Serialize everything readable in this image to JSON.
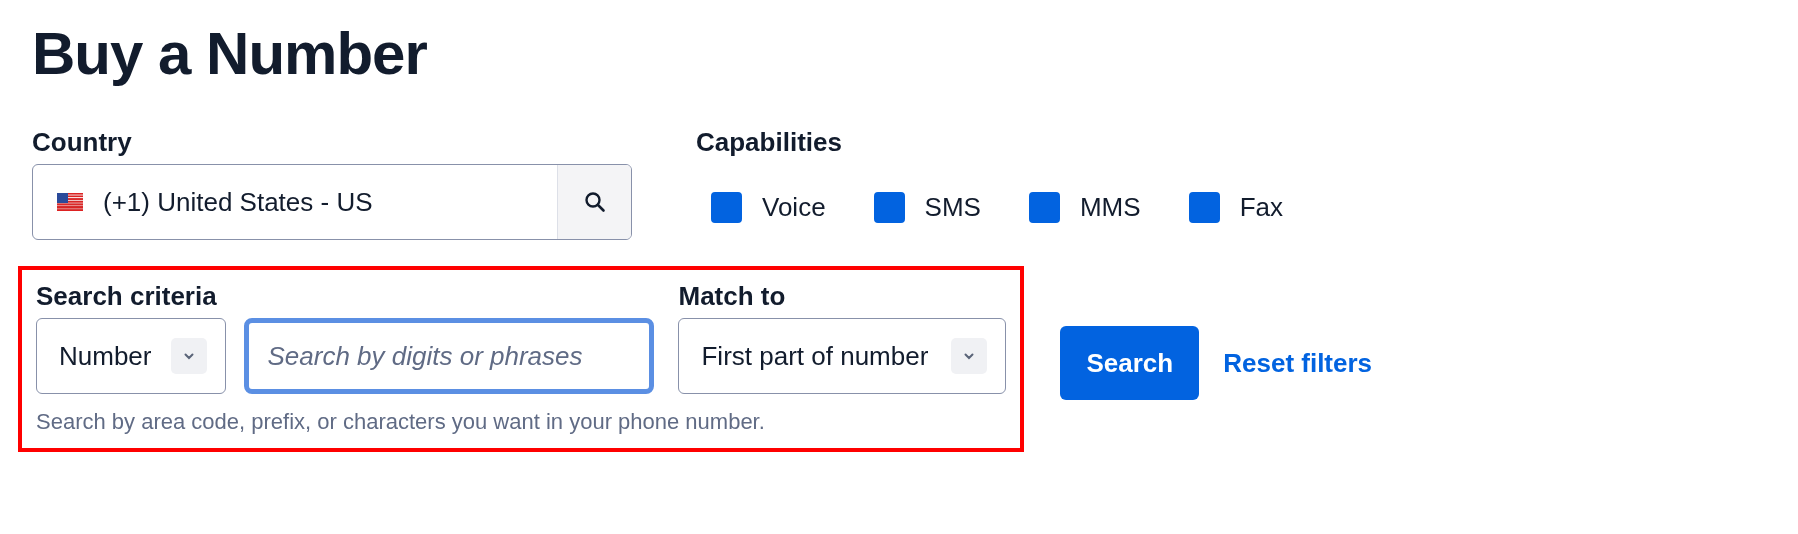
{
  "title": "Buy a Number",
  "country": {
    "label": "Country",
    "value": "(+1) United States - US"
  },
  "capabilities": {
    "label": "Capabilities",
    "options": [
      {
        "label": "Voice",
        "checked": true
      },
      {
        "label": "SMS",
        "checked": true
      },
      {
        "label": "MMS",
        "checked": true
      },
      {
        "label": "Fax",
        "checked": true
      }
    ]
  },
  "search_criteria": {
    "highlighted": true,
    "label": "Search criteria",
    "type_value": "Number",
    "placeholder": "Search by digits or phrases",
    "focused": true,
    "hint": "Search by area code, prefix, or characters you want in your phone number."
  },
  "match_to": {
    "label": "Match to",
    "value": "First part of number"
  },
  "buttons": {
    "search": "Search",
    "reset": "Reset filters"
  }
}
